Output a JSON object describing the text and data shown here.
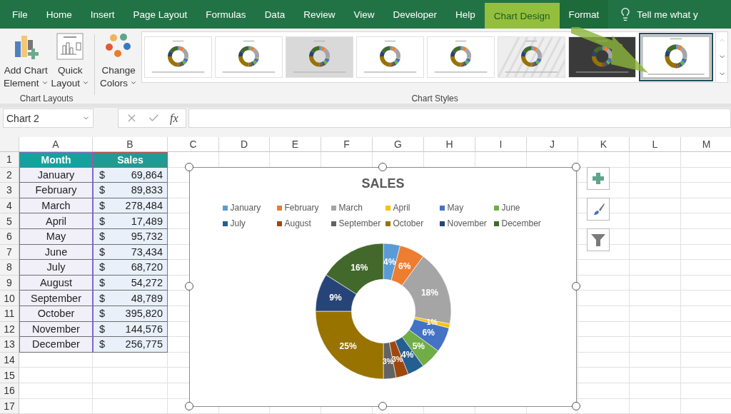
{
  "tabs": [
    {
      "label": "File",
      "selected": false,
      "kind": "normal"
    },
    {
      "label": "Home",
      "selected": false,
      "kind": "normal"
    },
    {
      "label": "Insert",
      "selected": false,
      "kind": "normal"
    },
    {
      "label": "Page Layout",
      "selected": false,
      "kind": "normal"
    },
    {
      "label": "Formulas",
      "selected": false,
      "kind": "normal"
    },
    {
      "label": "Data",
      "selected": false,
      "kind": "normal"
    },
    {
      "label": "Review",
      "selected": false,
      "kind": "normal"
    },
    {
      "label": "View",
      "selected": false,
      "kind": "normal"
    },
    {
      "label": "Developer",
      "selected": false,
      "kind": "normal"
    },
    {
      "label": "Help",
      "selected": false,
      "kind": "normal"
    },
    {
      "label": "Chart Design",
      "selected": true,
      "kind": "contextual"
    },
    {
      "label": "Format",
      "selected": false,
      "kind": "contextual"
    }
  ],
  "tell_me": "Tell me what y",
  "ribbon": {
    "layouts_group": {
      "label": "Chart Layouts",
      "buttons": [
        {
          "lines": [
            "Add Chart",
            "Element"
          ],
          "kind": "add-element"
        },
        {
          "lines": [
            "Quick",
            "Layout"
          ],
          "kind": "quick-layout"
        }
      ]
    },
    "colors_button": {
      "lines": [
        "Change",
        "Colors"
      ]
    },
    "styles_group": {
      "label": "Chart Styles",
      "thumbnails": [
        {
          "kind": "plain",
          "selected": false
        },
        {
          "kind": "plain",
          "selected": false
        },
        {
          "kind": "shaded",
          "selected": false
        },
        {
          "kind": "plain",
          "selected": false
        },
        {
          "kind": "plain",
          "selected": false
        },
        {
          "kind": "hatched",
          "selected": false
        },
        {
          "kind": "dark",
          "selected": false
        },
        {
          "kind": "framed",
          "selected": true
        }
      ]
    }
  },
  "formula_bar": {
    "name_box": "Chart 2",
    "fx": "fx"
  },
  "columns": [
    "A",
    "B",
    "C",
    "D",
    "E",
    "F",
    "G",
    "H",
    "I",
    "J",
    "K",
    "L",
    "M"
  ],
  "row_numbers": [
    "1",
    "2",
    "3",
    "4",
    "5",
    "6",
    "7",
    "8",
    "9",
    "10",
    "11",
    "12",
    "13",
    "14",
    "15",
    "16",
    "17"
  ],
  "table": {
    "headers": [
      "Month",
      "Sales"
    ],
    "rows": [
      {
        "month": "January",
        "currency": "$",
        "sales": "69,864"
      },
      {
        "month": "February",
        "currency": "$",
        "sales": "89,833"
      },
      {
        "month": "March",
        "currency": "$",
        "sales": "278,484"
      },
      {
        "month": "April",
        "currency": "$",
        "sales": "17,489"
      },
      {
        "month": "May",
        "currency": "$",
        "sales": "95,732"
      },
      {
        "month": "June",
        "currency": "$",
        "sales": "73,434"
      },
      {
        "month": "July",
        "currency": "$",
        "sales": "68,720"
      },
      {
        "month": "August",
        "currency": "$",
        "sales": "54,272"
      },
      {
        "month": "September",
        "currency": "$",
        "sales": "48,789"
      },
      {
        "month": "October",
        "currency": "$",
        "sales": "395,820"
      },
      {
        "month": "November",
        "currency": "$",
        "sales": "144,576"
      },
      {
        "month": "December",
        "currency": "$",
        "sales": "256,775"
      }
    ]
  },
  "chart": {
    "chart_data": {
      "type": "donut",
      "title": "SALES",
      "categories": [
        "January",
        "February",
        "March",
        "April",
        "May",
        "June",
        "July",
        "August",
        "September",
        "October",
        "November",
        "December"
      ],
      "values": [
        4,
        6,
        18,
        1,
        6,
        5,
        4,
        3,
        3,
        25,
        9,
        16
      ],
      "colors": [
        "#5b9bd5",
        "#ed7d31",
        "#a5a5a5",
        "#ffc000",
        "#4472c4",
        "#70ad47",
        "#255e91",
        "#9e480e",
        "#636363",
        "#997300",
        "#264478",
        "#43682b"
      ],
      "value_labels": [
        "4%",
        "6%",
        "18%",
        "1%",
        "6%",
        "5%",
        "4%",
        "3%",
        "3%",
        "25%",
        "9%",
        "16%"
      ]
    }
  }
}
